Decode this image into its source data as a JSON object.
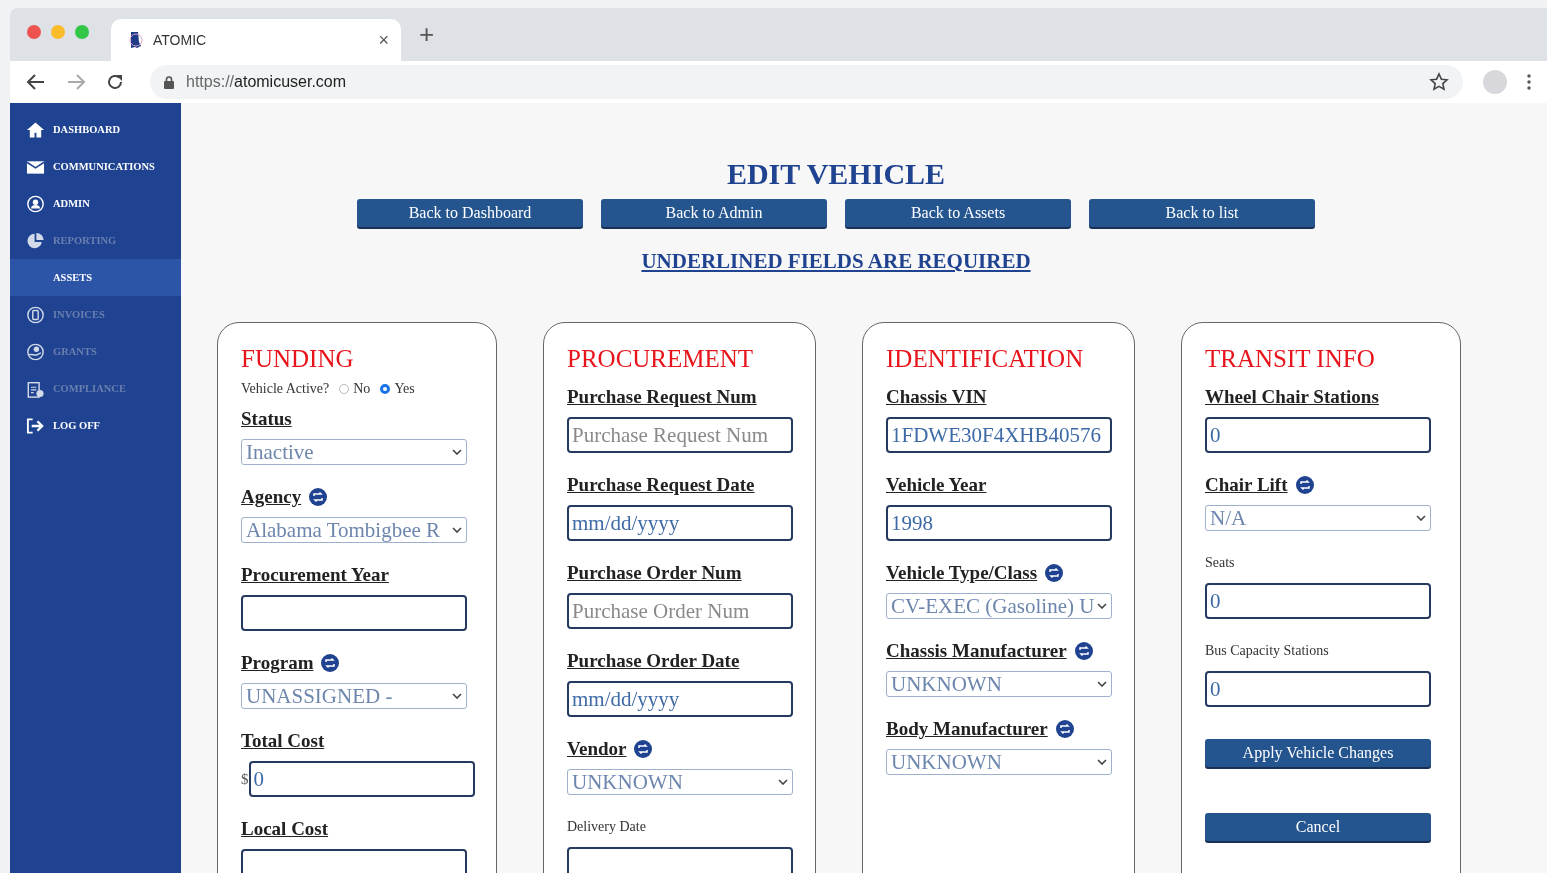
{
  "browser": {
    "tab_title": "ATOMIC",
    "tab_close": "×",
    "new_tab": "+",
    "url_scheme": "https://",
    "url_host": "atomicuser.com"
  },
  "sidebar": {
    "items": [
      {
        "label": "DASHBOARD",
        "disabled": false,
        "selected": false
      },
      {
        "label": "COMMUNICATIONS",
        "disabled": false,
        "selected": false
      },
      {
        "label": "ADMIN",
        "disabled": false,
        "selected": false
      },
      {
        "label": "REPORTING",
        "disabled": true,
        "selected": false
      },
      {
        "label": "ASSETS",
        "disabled": false,
        "selected": true
      },
      {
        "label": "INVOICES",
        "disabled": true,
        "selected": false
      },
      {
        "label": "GRANTS",
        "disabled": true,
        "selected": false
      },
      {
        "label": "COMPLIANCE",
        "disabled": true,
        "selected": false
      },
      {
        "label": "LOG OFF",
        "disabled": false,
        "selected": false
      }
    ]
  },
  "page": {
    "title": "EDIT VEHICLE",
    "nav_buttons": [
      "Back to Dashboard",
      "Back to Admin",
      "Back to Assets",
      "Back to list"
    ],
    "required_note": "UNDERLINED FIELDS ARE REQUIRED"
  },
  "sections": [
    {
      "title": "FUNDING",
      "fields": [
        {
          "kind": "radio",
          "label": "Vehicle Active?",
          "options": [
            {
              "label": "No",
              "selected": false
            },
            {
              "label": "Yes",
              "selected": true
            }
          ]
        },
        {
          "kind": "select",
          "label": "Status",
          "required": true,
          "value": "Inactive"
        },
        {
          "kind": "select",
          "label": "Agency",
          "required": true,
          "sync": true,
          "value": "Alabama Tombigbee R"
        },
        {
          "kind": "input",
          "label": "Procurement Year",
          "required": true
        },
        {
          "kind": "select",
          "label": "Program",
          "required": true,
          "sync": true,
          "value": "UNASSIGNED -"
        },
        {
          "kind": "money",
          "label": "Total Cost",
          "required": true,
          "prefix": "$",
          "value": "0"
        },
        {
          "kind": "input",
          "label": "Local Cost",
          "required": true
        }
      ]
    },
    {
      "title": "PROCUREMENT",
      "fields": [
        {
          "kind": "input",
          "label": "Purchase Request Num",
          "required": true,
          "placeholder": "Purchase Request Num"
        },
        {
          "kind": "date",
          "label": "Purchase Request Date",
          "required": true,
          "placeholder": "mm/dd/yyyy"
        },
        {
          "kind": "input",
          "label": "Purchase Order Num",
          "required": true,
          "placeholder": "Purchase Order Num"
        },
        {
          "kind": "date",
          "label": "Purchase Order Date",
          "required": true,
          "placeholder": "mm/dd/yyyy"
        },
        {
          "kind": "select",
          "label": "Vendor",
          "required": true,
          "sync": true,
          "value": "UNKNOWN"
        },
        {
          "kind": "input",
          "label": "Delivery Date",
          "required": false
        }
      ]
    },
    {
      "title": "IDENTIFICATION",
      "fields": [
        {
          "kind": "input",
          "label": "Chassis VIN",
          "required": true,
          "value": "1FDWE30F4XHB40576"
        },
        {
          "kind": "input",
          "label": "Vehicle Year",
          "required": true,
          "value": "1998"
        },
        {
          "kind": "select",
          "label": "Vehicle Type/Class",
          "required": true,
          "sync": true,
          "value": "CV-EXEC (Gasoline) U"
        },
        {
          "kind": "select",
          "label": "Chassis Manufacturer",
          "required": true,
          "sync": true,
          "value": "UNKNOWN"
        },
        {
          "kind": "select",
          "label": "Body Manufacturer",
          "required": true,
          "sync": true,
          "value": "UNKNOWN"
        }
      ]
    },
    {
      "title": "TRANSIT INFO",
      "fields": [
        {
          "kind": "input",
          "label": "Wheel Chair Stations",
          "required": true,
          "value": "0"
        },
        {
          "kind": "select",
          "label": "Chair Lift",
          "required": true,
          "sync": true,
          "value": "N/A"
        },
        {
          "kind": "input",
          "label": "Seats",
          "required": false,
          "value": "0"
        },
        {
          "kind": "input",
          "label": "Bus Capacity Stations",
          "required": false,
          "value": "0"
        },
        {
          "kind": "button",
          "label": "Apply Vehicle Changes"
        },
        {
          "kind": "button",
          "label": "Cancel"
        }
      ]
    }
  ]
}
